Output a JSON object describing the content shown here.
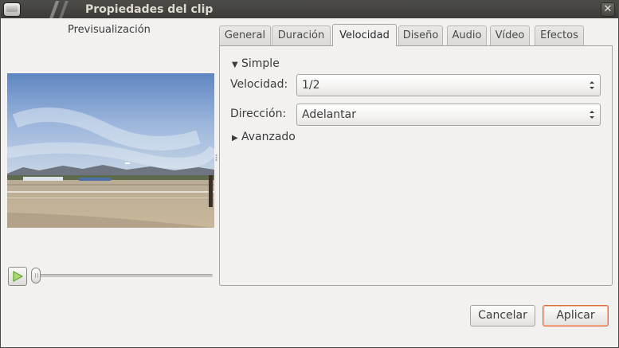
{
  "window": {
    "title": "Propiedades del clip",
    "close_glyph": "✕"
  },
  "preview": {
    "label": "Previsualización"
  },
  "tabs": [
    {
      "label": "General",
      "active": false
    },
    {
      "label": "Duración",
      "active": false
    },
    {
      "label": "Velocidad",
      "active": true
    },
    {
      "label": "Diseño",
      "active": false
    },
    {
      "label": "Audio",
      "active": false
    },
    {
      "label": "Vídeo",
      "active": false
    },
    {
      "label": "Efectos",
      "active": false
    }
  ],
  "velocidad": {
    "simple_label": "Simple",
    "simple_expanded": true,
    "speed_label": "Velocidad:",
    "speed_value": "1/2",
    "direction_label": "Dirección:",
    "direction_value": "Adelantar",
    "advanced_label": "Avanzado",
    "advanced_expanded": false
  },
  "buttons": {
    "cancel": "Cancelar",
    "apply": "Aplicar"
  },
  "colors": {
    "titlebar": "#3c3b37",
    "default_button_border": "#e26a3b",
    "play_icon": "#5fa62a"
  },
  "icons": {
    "play": "play-icon",
    "expand_open": "triangle-down-icon",
    "expand_closed": "triangle-right-icon",
    "combo": "up-down-arrows-icon"
  }
}
